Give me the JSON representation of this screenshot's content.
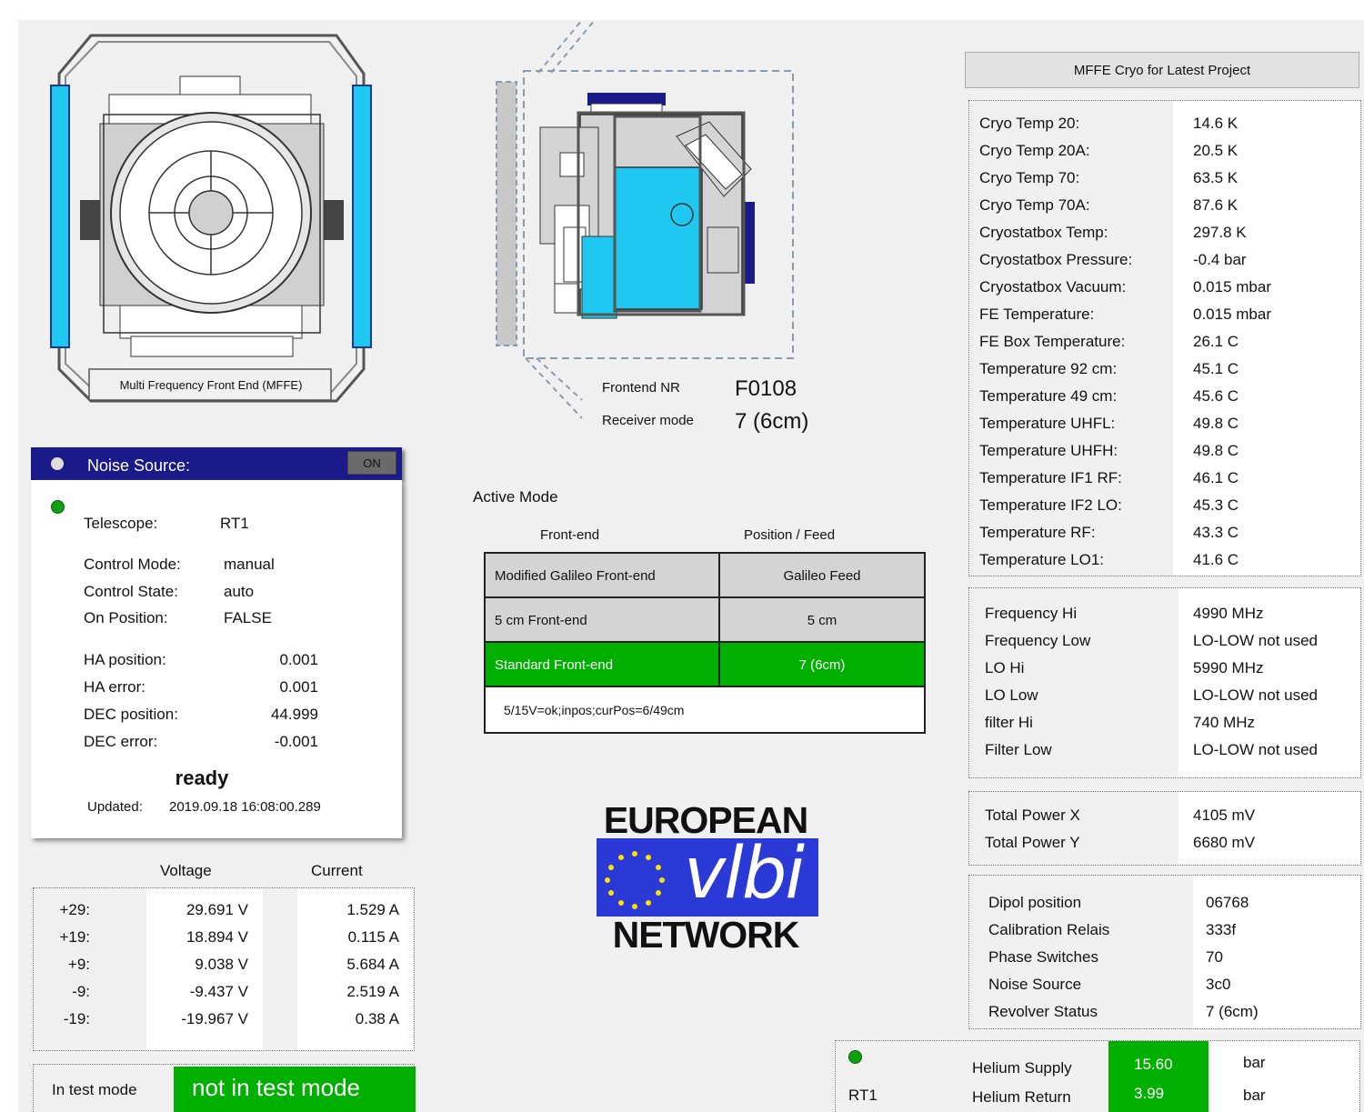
{
  "mffe": {
    "label": "Multi Frequency Front End (MFFE)",
    "frontend_nr_label": "Frontend NR",
    "frontend_nr_value": "F0108",
    "receiver_mode_label": "Receiver mode",
    "receiver_mode_value": "7 (6cm)"
  },
  "noise_source": {
    "title": "Noise Source:",
    "toggle_label": "ON",
    "telescope_label": "Telescope:",
    "telescope_value": "RT1",
    "control_mode_label": "Control Mode:",
    "control_mode_value": "manual",
    "control_state_label": "Control State:",
    "control_state_value": "auto",
    "on_position_label": "On Position:",
    "on_position_value": "FALSE",
    "ha_position_label": "HA position:",
    "ha_position_value": "0.001",
    "ha_error_label": "HA error:",
    "ha_error_value": "0.001",
    "dec_position_label": "DEC position:",
    "dec_position_value": "44.999",
    "dec_error_label": "DEC error:",
    "dec_error_value": "-0.001",
    "status": "ready",
    "updated_label": "Updated:",
    "updated_value": "2019.09.18 16:08:00.289"
  },
  "power": {
    "voltage_header": "Voltage",
    "current_header": "Current",
    "rows": [
      {
        "label": "+29:",
        "voltage": "29.691 V",
        "current": "1.529 A"
      },
      {
        "label": "+19:",
        "voltage": "18.894 V",
        "current": "0.115 A"
      },
      {
        "label": "+9:",
        "voltage": "9.038 V",
        "current": "5.684 A"
      },
      {
        "label": "-9:",
        "voltage": "-9.437 V",
        "current": "2.519 A"
      },
      {
        "label": "-19:",
        "voltage": "-19.967 V",
        "current": "0.38 A"
      }
    ]
  },
  "test_mode": {
    "label": "In test mode",
    "value": "not in test mode"
  },
  "active_mode": {
    "title": "Active Mode",
    "col_frontend": "Front-end",
    "col_position": "Position / Feed",
    "rows": [
      {
        "frontend": "Modified Galileo Front-end",
        "position": "Galileo Feed"
      },
      {
        "frontend": "5 cm Front-end",
        "position": "5 cm"
      },
      {
        "frontend": "Standard Front-end",
        "position": "7 (6cm)"
      }
    ],
    "status_line": "5/15V=ok;inpos;curPos=6/49cm"
  },
  "logo": {
    "top": "EUROPEAN",
    "middle": "vlbi",
    "bottom": "NETWORK"
  },
  "cryo": {
    "title": "MFFE Cryo for Latest Project",
    "rows": [
      {
        "label": "Cryo Temp 20:",
        "value": "14.6 K"
      },
      {
        "label": "Cryo Temp 20A:",
        "value": "20.5 K"
      },
      {
        "label": "Cryo Temp 70:",
        "value": "63.5 K"
      },
      {
        "label": "Cryo Temp 70A:",
        "value": "87.6 K"
      },
      {
        "label": "Cryostatbox Temp:",
        "value": "297.8 K"
      },
      {
        "label": "Cryostatbox Pressure:",
        "value": "-0.4 bar"
      },
      {
        "label": "Cryostatbox Vacuum:",
        "value": "0.015 mbar"
      },
      {
        "label": "FE Temperature:",
        "value": "0.015 mbar"
      },
      {
        "label": "FE Box Temperature:",
        "value": "26.1 C"
      },
      {
        "label": "Temperature 92 cm:",
        "value": "45.1 C"
      },
      {
        "label": "Temperature 49 cm:",
        "value": "45.6 C"
      },
      {
        "label": "Temperature UHFL:",
        "value": "49.8 C"
      },
      {
        "label": "Temperature UHFH:",
        "value": "49.8 C"
      },
      {
        "label": "Temperature IF1 RF:",
        "value": "46.1 C"
      },
      {
        "label": "Temperature IF2 LO:",
        "value": "45.3 C"
      },
      {
        "label": "Temperature RF:",
        "value": "43.3 C"
      },
      {
        "label": "Temperature LO1:",
        "value": "41.6 C"
      }
    ]
  },
  "frequency": {
    "rows": [
      {
        "label": "Frequency Hi",
        "value": "4990 MHz"
      },
      {
        "label": "Frequency Low",
        "value": "LO-LOW not used"
      },
      {
        "label": "LO Hi",
        "value": "5990 MHz"
      },
      {
        "label": "LO Low",
        "value": "LO-LOW not used"
      },
      {
        "label": "filter Hi",
        "value": "740 MHz"
      },
      {
        "label": "Filter Low",
        "value": "LO-LOW not used"
      }
    ]
  },
  "total_power": {
    "rows": [
      {
        "label": "Total Power X",
        "value": "4105 mV"
      },
      {
        "label": "Total Power Y",
        "value": "6680 mV"
      }
    ]
  },
  "dipol": {
    "rows": [
      {
        "label": "Dipol position",
        "value": "06768"
      },
      {
        "label": "Calibration Relais",
        "value": "333f"
      },
      {
        "label": "Phase Switches",
        "value": "70"
      },
      {
        "label": "Noise Source",
        "value": "3c0"
      },
      {
        "label": "Revolver Status",
        "value": "7 (6cm)"
      }
    ]
  },
  "helium": {
    "telescope": "RT1",
    "supply_label": "Helium Supply",
    "supply_value": "15.60",
    "supply_unit": "bar",
    "return_label": "Helium Return",
    "return_value": "3.99",
    "return_unit": "bar"
  },
  "colors": {
    "panel_bg": "#f0f0f0",
    "active_green": "#00b000",
    "header_navy": "#1a1a8a",
    "cyan": "#1ec8f0",
    "logo_blue": "#2b3ad6"
  }
}
